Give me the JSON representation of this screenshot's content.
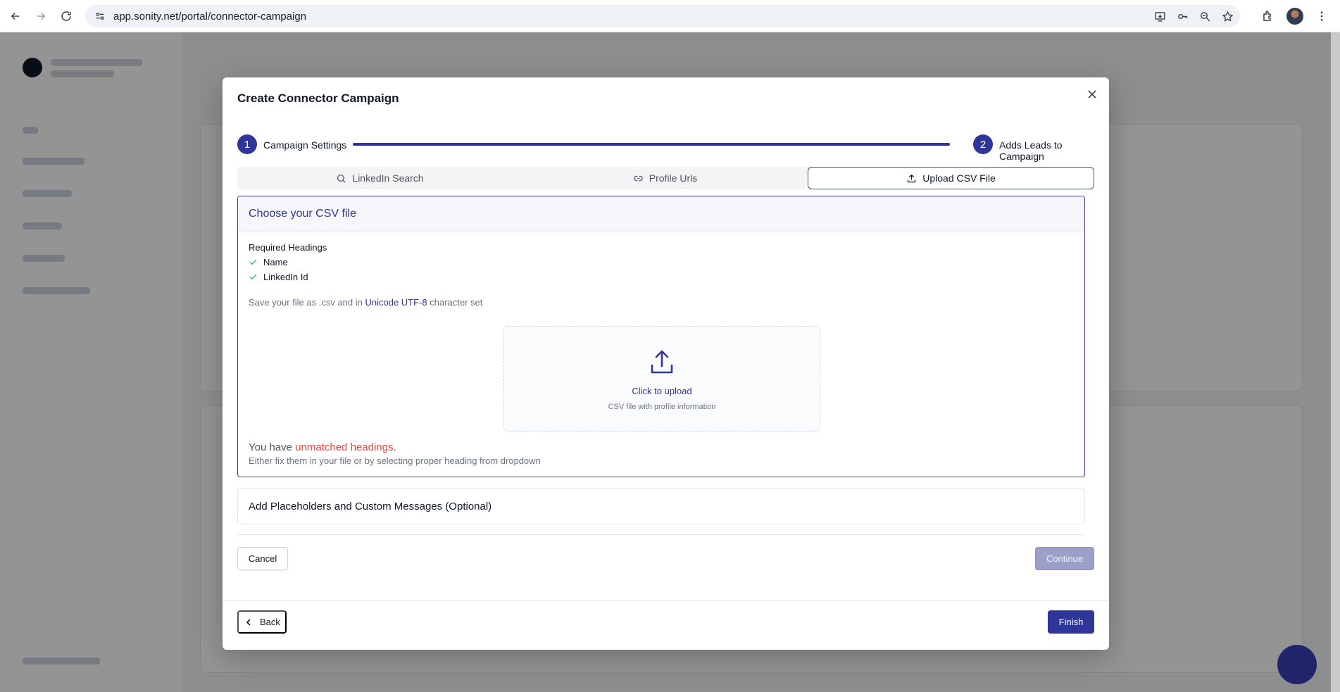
{
  "browser": {
    "url": "app.sonity.net/portal/connector-campaign"
  },
  "modal": {
    "title": "Create Connector Campaign",
    "steps": [
      {
        "number": "1",
        "label": "Campaign Settings"
      },
      {
        "number": "2",
        "label": "Adds Leads to Campaign"
      }
    ],
    "tabs": [
      {
        "label": "LinkedIn Search",
        "icon": "search-icon"
      },
      {
        "label": "Profile Urls",
        "icon": "link-icon"
      },
      {
        "label": "Upload CSV File",
        "icon": "upload-icon",
        "active": true
      }
    ],
    "csv_panel": {
      "title": "Choose your CSV file",
      "required_title": "Required Headings",
      "required_items": [
        "Name",
        "LinkedIn Id"
      ],
      "note_prefix": "Save your file as .csv and in ",
      "note_link": "Unicode UTF-8",
      "note_suffix": " character set",
      "upload_title": "Click to upload",
      "upload_subtitle": "CSV file with profile information",
      "warning_prefix": "You have ",
      "warning_highlight": "unmatched headings",
      "warning_suffix": ".",
      "warning_detail": "Either fix them in your file or by selecting proper heading from dropdown"
    },
    "placeholders_section": {
      "title": "Add Placeholders and Custom Messages (Optional)"
    },
    "buttons": {
      "cancel": "Cancel",
      "continue": "Continue",
      "back": "Back",
      "finish": "Finish"
    }
  },
  "colors": {
    "primary": "#2f3699",
    "warning": "#ef4444",
    "success": "#22c55e"
  }
}
